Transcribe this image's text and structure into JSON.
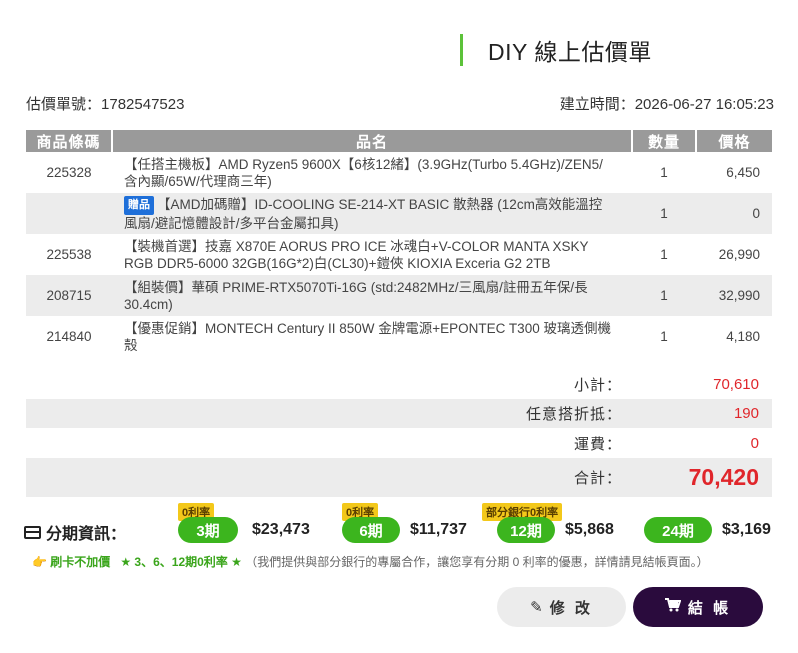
{
  "header": {
    "title": "DIY 線上估價單"
  },
  "meta": {
    "quote_no_label": "估價單號：",
    "quote_no": "1782547523",
    "created_label": "建立時間：",
    "created": "2026-06-27 16:05:23"
  },
  "table": {
    "headers": {
      "code": "商品條碼",
      "name": "品名",
      "qty": "數量",
      "price": "價格"
    },
    "rows": [
      {
        "code": "225328",
        "badge": "",
        "name": "【任搭主機板】AMD Ryzen5 9600X【6核12緒】(3.9GHz(Turbo 5.4GHz)/ZEN5/含內顯/65W/代理商三年)",
        "qty": "1",
        "price": "6,450"
      },
      {
        "code": "",
        "badge": "贈品",
        "name": "【AMD加碼贈】ID-COOLING SE-214-XT BASIC 散熱器 (12cm高效能溫控風扇/避記憶體設計/多平台金屬扣具)",
        "qty": "1",
        "price": "0"
      },
      {
        "code": "225538",
        "badge": "",
        "name": "【裝機首選】技嘉 X870E AORUS PRO ICE 冰魂白+V-COLOR MANTA XSKY RGB DDR5-6000 32GB(16G*2)白(CL30)+鎧俠 KIOXIA Exceria G2 2TB",
        "qty": "1",
        "price": "26,990"
      },
      {
        "code": "208715",
        "badge": "",
        "name": "【組裝價】華碩 PRIME-RTX5070Ti-16G (std:2482MHz/三風扇/註冊五年保/長30.4cm)",
        "qty": "1",
        "price": "32,990"
      },
      {
        "code": "214840",
        "badge": "",
        "name": "【優惠促銷】MONTECH Century II 850W 金牌電源+EPONTEC T300 玻璃透側機殼",
        "qty": "1",
        "price": "4,180"
      }
    ]
  },
  "summary": {
    "subtotal_label": "小計：",
    "subtotal": "70,610",
    "discount_label": "任意搭折抵：",
    "discount": "190",
    "shipping_label": "運費：",
    "shipping": "0",
    "total_label": "合計：",
    "total": "70,420"
  },
  "installment": {
    "label": "分期資訊：",
    "plans": [
      {
        "tag": "0利率",
        "term": "3期",
        "amount": "$23,473"
      },
      {
        "tag": "0利率",
        "term": "6期",
        "amount": "$11,737"
      },
      {
        "tag": "部分銀行0利率",
        "term": "12期",
        "amount": "$5,868"
      },
      {
        "tag": "",
        "term": "24期",
        "amount": "$3,169"
      }
    ]
  },
  "note": {
    "hand": "👉",
    "highlight1": "刷卡不加價",
    "highlight2": "★ 3、6、12期0利率 ★",
    "text": "（我們提供與部分銀行的專屬合作，讓您享有分期 0 利率的優惠，詳情請見結帳頁面。）"
  },
  "actions": {
    "edit": "修 改",
    "checkout": "結 帳"
  },
  "colors": {
    "accent_green": "#3cb51e",
    "price_red": "#e0262b",
    "checkout_bg": "#2a0b3d",
    "tag_yellow": "#f3c81a"
  }
}
